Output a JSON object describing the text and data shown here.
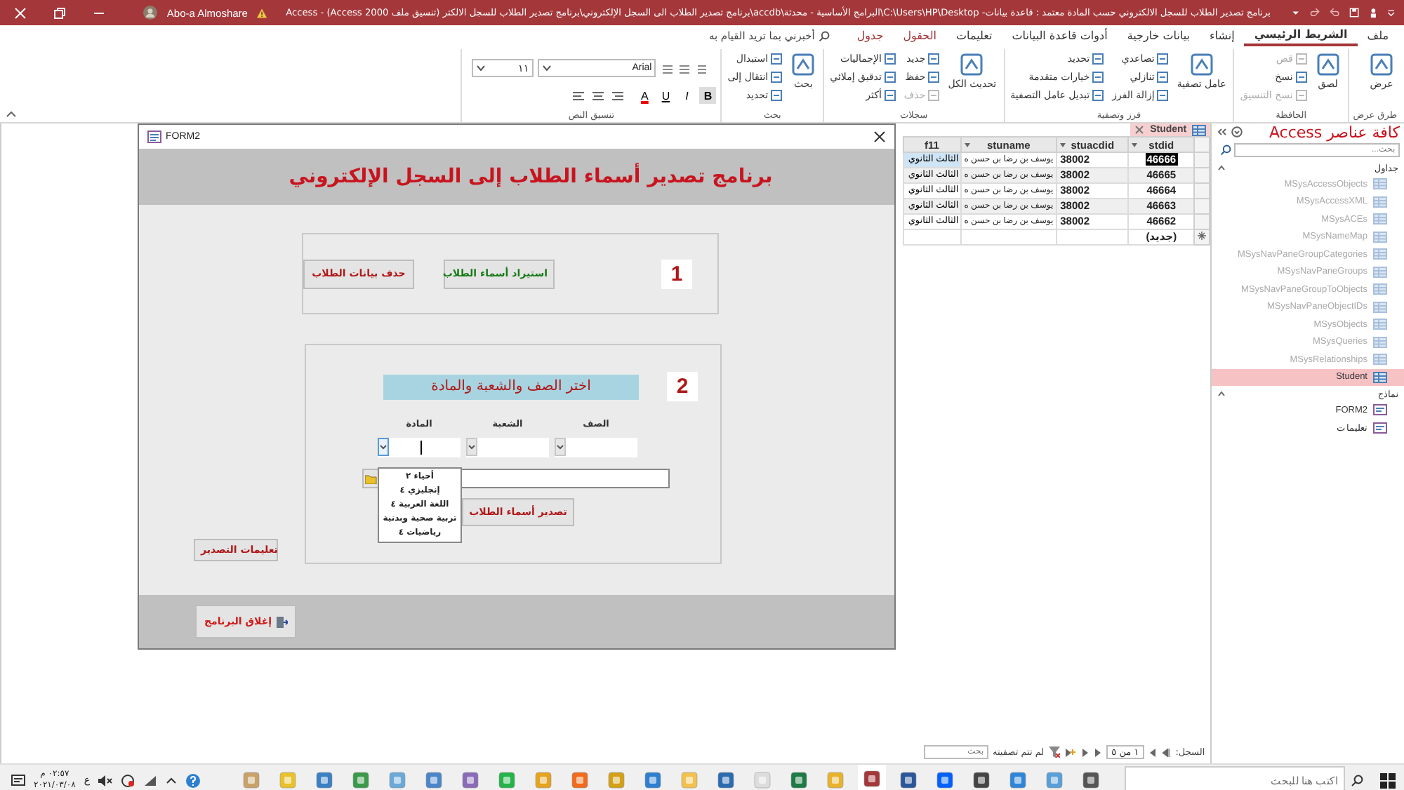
{
  "title_bar": {
    "title": "برنامج تصدير الطلاب للسجل الالكتروني حسب المادة معتمد : قاعدة بيانات- C:\\Users\\HP\\Desktop\\البرامج الأساسية - محدثة\\accdb\\برنامج تصدير الطلاب الى السجل الإلكتروني\\برنامج تصدير الطلاب للسجل الالكتر (تنسيق ملف Access 2000) - Access",
    "user": "Abo-a Almoshare"
  },
  "ribbon": {
    "tabs": [
      {
        "label": "ملف",
        "selected": false,
        "contextual": false
      },
      {
        "label": "الشريط الرئيسي",
        "selected": true,
        "contextual": false
      },
      {
        "label": "إنشاء",
        "selected": false,
        "contextual": false
      },
      {
        "label": "بيانات خارجية",
        "selected": false,
        "contextual": false
      },
      {
        "label": "أدوات قاعدة البيانات",
        "selected": false,
        "contextual": false
      },
      {
        "label": "تعليمات",
        "selected": false,
        "contextual": false
      },
      {
        "label": "الحقول",
        "selected": false,
        "contextual": true
      },
      {
        "label": "جدول",
        "selected": false,
        "contextual": true
      }
    ],
    "tell_me": "أخبرني بما تريد القيام به",
    "groups": [
      {
        "name": "طرق عرض",
        "items": [
          {
            "label": "عرض",
            "kind": "large",
            "disabled": false
          }
        ]
      },
      {
        "name": "الحافظة",
        "items": [
          {
            "label": "لصق",
            "kind": "large",
            "disabled": false
          },
          {
            "label": "قص",
            "kind": "small",
            "disabled": true
          },
          {
            "label": "نسخ",
            "kind": "small",
            "disabled": false
          },
          {
            "label": "نسخ التنسيق",
            "kind": "small",
            "disabled": true
          }
        ]
      },
      {
        "name": "فرز وتصفية",
        "items": [
          {
            "label": "عامل تصفية",
            "kind": "large",
            "disabled": false
          },
          {
            "label": "تصاعدي",
            "kind": "small",
            "disabled": false
          },
          {
            "label": "تنازلي",
            "kind": "small",
            "disabled": false
          },
          {
            "label": "إزالة الفرز",
            "kind": "small",
            "disabled": false
          },
          {
            "label": "تحديد",
            "kind": "small",
            "disabled": false
          },
          {
            "label": "خيارات متقدمة",
            "kind": "small",
            "disabled": false
          },
          {
            "label": "تبديل عامل التصفية",
            "kind": "small",
            "disabled": false
          }
        ]
      },
      {
        "name": "سجلات",
        "items": [
          {
            "label": "تحديث الكل",
            "kind": "large",
            "disabled": false
          },
          {
            "label": "جديد",
            "kind": "small",
            "disabled": false
          },
          {
            "label": "حفظ",
            "kind": "small",
            "disabled": false
          },
          {
            "label": "حذف",
            "kind": "small",
            "disabled": true
          },
          {
            "label": "الإجماليات",
            "kind": "small",
            "disabled": false
          },
          {
            "label": "تدقيق إملائي",
            "kind": "small",
            "disabled": false
          },
          {
            "label": "أكثر",
            "kind": "small",
            "disabled": false
          }
        ]
      },
      {
        "name": "بحث",
        "items": [
          {
            "label": "بحث",
            "kind": "large",
            "disabled": false
          },
          {
            "label": "استبدال",
            "kind": "small",
            "disabled": false
          },
          {
            "label": "انتقال إلى",
            "kind": "small",
            "disabled": false
          },
          {
            "label": "تحديد",
            "kind": "small",
            "disabled": false
          }
        ]
      },
      {
        "name": "تنسيق النص",
        "items": [
          {
            "label": "Arial",
            "kind": "combo"
          },
          {
            "label": "١١",
            "kind": "combo"
          },
          {
            "label": "B",
            "kind": "toggle"
          },
          {
            "label": "I",
            "kind": "toggle"
          },
          {
            "label": "U",
            "kind": "toggle"
          },
          {
            "label": "A",
            "kind": "color"
          }
        ]
      }
    ]
  },
  "datasheet": {
    "tab": "Student",
    "columns": [
      "stdid",
      "stuacdid",
      "stuname",
      "f11"
    ],
    "rows": [
      {
        "cells": [
          "46666",
          "38002",
          "يوسف بن رضا بن حسن ه",
          "الثالث الثانوي"
        ],
        "selected": true
      },
      {
        "cells": [
          "46665",
          "38002",
          "يوسف بن رضا بن حسن ه",
          "الثالث الثانوي"
        ],
        "selected": false
      },
      {
        "cells": [
          "46664",
          "38002",
          "يوسف بن رضا بن حسن ه",
          "الثالث الثانوي"
        ],
        "selected": false
      },
      {
        "cells": [
          "46663",
          "38002",
          "يوسف بن رضا بن حسن ه",
          "الثالث الثانوي"
        ],
        "selected": false
      },
      {
        "cells": [
          "46662",
          "38002",
          "يوسف بن رضا بن حسن ه",
          "الثالث الثانوي"
        ],
        "selected": false
      }
    ],
    "new_row": "(جديد)",
    "record_nav": {
      "label": "السجل:",
      "position": "١ من ٥",
      "filter": "لم تتم تصفيته",
      "search_placeholder": "بحث"
    }
  },
  "form": {
    "title": "FORM2",
    "heading": "برنامج تصدير أسماء الطلاب إلى السجل الإلكتروني",
    "step1": {
      "number": "1",
      "buttons": [
        {
          "label": "استيراد أسماء الطلاب",
          "kind": "import"
        },
        {
          "label": "حذف بيانات الطلاب",
          "kind": "delete"
        }
      ]
    },
    "step2": {
      "number": "2",
      "prompt": "اختر الصف والشعبة والمادة",
      "fields": [
        {
          "label": "الصف",
          "open": false
        },
        {
          "label": "الشعبة",
          "open": false
        },
        {
          "label": "المادة",
          "open": true,
          "options": [
            "أحياء ٢",
            "إنجليزي ٤",
            "اللغة العربية ٤",
            "تربية صحية وبدنية",
            "رياضيات ٤"
          ]
        }
      ],
      "export_button": "تصدير أسماء الطلاب"
    },
    "instructions_button": "تعليمات التصدير",
    "close_button": "إغلاق البرنامج"
  },
  "nav_pane": {
    "title": "كافة عناصر Access",
    "search_placeholder": "بحث...",
    "groups": [
      {
        "label": "جداول",
        "expanded": true,
        "items": [
          {
            "label": "MSysAccessObjects",
            "dimmed": true,
            "selected": false
          },
          {
            "label": "MSysAccessXML",
            "dimmed": true,
            "selected": false
          },
          {
            "label": "MSysACEs",
            "dimmed": true,
            "selected": false
          },
          {
            "label": "MSysNameMap",
            "dimmed": true,
            "selected": false
          },
          {
            "label": "MSysNavPaneGroupCategories",
            "dimmed": true,
            "selected": false
          },
          {
            "label": "MSysNavPaneGroups",
            "dimmed": true,
            "selected": false
          },
          {
            "label": "MSysNavPaneGroupToObjects",
            "dimmed": true,
            "selected": false
          },
          {
            "label": "MSysNavPaneObjectIDs",
            "dimmed": true,
            "selected": false
          },
          {
            "label": "MSysObjects",
            "dimmed": true,
            "selected": false
          },
          {
            "label": "MSysQueries",
            "dimmed": true,
            "selected": false
          },
          {
            "label": "MSysRelationships",
            "dimmed": true,
            "selected": false
          },
          {
            "label": "Student",
            "dimmed": false,
            "selected": true
          }
        ]
      },
      {
        "label": "نماذج",
        "expanded": true,
        "items": [
          {
            "label": "FORM2",
            "dimmed": false,
            "selected": false
          },
          {
            "label": "تعليمات",
            "dimmed": false,
            "selected": false
          }
        ]
      }
    ]
  },
  "taskbar": {
    "search_placeholder": "اكتب هنا للبحث",
    "time": "٠٢:٥٧ م",
    "date": "٢٠٢١/٠٣/٠٨",
    "language": "ع",
    "apps": [
      {
        "active": false
      },
      {
        "active": false
      },
      {
        "active": false
      },
      {
        "active": false
      },
      {
        "active": false
      },
      {
        "active": false
      },
      {
        "active": false
      },
      {
        "active": false
      },
      {
        "active": false
      },
      {
        "active": false
      },
      {
        "active": false
      },
      {
        "active": false
      },
      {
        "active": false
      },
      {
        "active": false
      },
      {
        "active": false
      },
      {
        "active": false
      },
      {
        "active": false
      },
      {
        "active": true
      },
      {
        "active": false
      },
      {
        "active": false
      },
      {
        "active": false
      },
      {
        "active": false
      },
      {
        "active": false
      },
      {
        "active": false
      }
    ]
  }
}
